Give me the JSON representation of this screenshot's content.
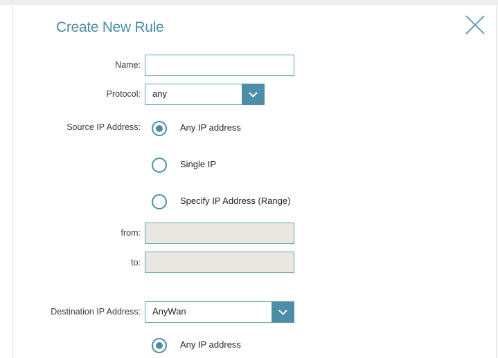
{
  "dialog": {
    "title": "Create New Rule",
    "close_icon": "close-icon"
  },
  "form": {
    "name_label": "Name:",
    "name_value": "",
    "protocol_label": "Protocol:",
    "protocol_value": "any",
    "source_label": "Source IP Address:",
    "source_options": [
      {
        "label": "Any IP address",
        "selected": true
      },
      {
        "label": "Single IP",
        "selected": false
      },
      {
        "label": "Specify IP Address (Range)",
        "selected": false
      }
    ],
    "from_label": "from:",
    "from_value": "",
    "to_label": "to:",
    "to_value": "",
    "destination_label": "Destination IP Address:",
    "destination_value": "AnyWan",
    "destination_options": [
      {
        "label": "Any IP address",
        "selected": true
      }
    ]
  },
  "colors": {
    "accent": "#4b8ea5",
    "border": "#5da2b5",
    "disabled_bg": "#eae8e3"
  }
}
